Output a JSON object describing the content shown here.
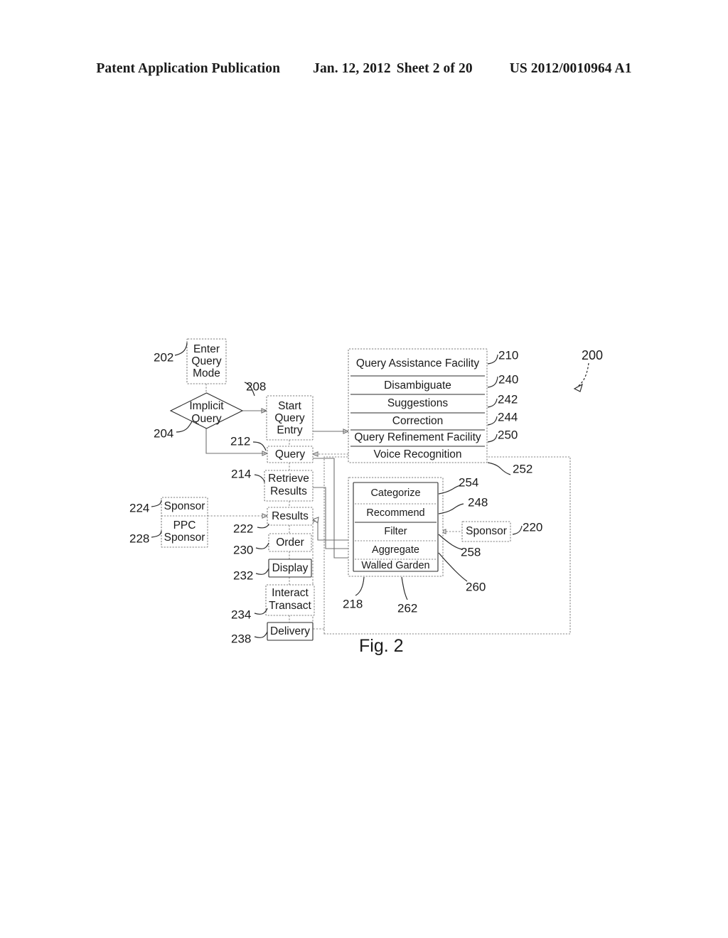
{
  "header": {
    "title": "Patent Application Publication",
    "date": "Jan. 12, 2012",
    "sheet": "Sheet 2 of 20",
    "pub_number": "US 2012/0010964 A1"
  },
  "figure": {
    "caption": "Fig. 2",
    "overall_ref": "200",
    "nodes": {
      "enter_query_mode": {
        "label_lines": [
          "Enter",
          "Query",
          "Mode"
        ],
        "ref": "202"
      },
      "implicit_query": {
        "label_lines": [
          "Implicit",
          "Query"
        ],
        "ref": "204"
      },
      "start_query_entry": {
        "label_lines": [
          "Start",
          "Query",
          "Entry"
        ],
        "ref": "208"
      },
      "query": {
        "label_lines": [
          "Query"
        ],
        "ref": "212"
      },
      "retrieve_results": {
        "label_lines": [
          "Retrieve",
          "Results"
        ],
        "ref": "214"
      },
      "results": {
        "label_lines": [
          "Results"
        ],
        "ref": "222"
      },
      "order": {
        "label_lines": [
          "Order"
        ],
        "ref": "230"
      },
      "display": {
        "label_lines": [
          "Display"
        ],
        "ref": "232"
      },
      "interact_transact": {
        "label_lines": [
          "Interact",
          "Transact"
        ],
        "ref": "234"
      },
      "delivery": {
        "label_lines": [
          "Delivery"
        ],
        "ref": "238"
      },
      "sponsor_left": {
        "label_lines": [
          "Sponsor"
        ],
        "ref": "224"
      },
      "ppc_sponsor": {
        "label_lines": [
          "PPC",
          "Sponsor"
        ],
        "ref": "228"
      },
      "sponsor_right": {
        "label_lines": [
          "Sponsor"
        ],
        "ref": "220"
      }
    },
    "query_assistance_panel": {
      "group_ref": "252",
      "rows": [
        {
          "label": "Query Assistance Facility",
          "ref": "210"
        },
        {
          "label": "Disambiguate",
          "ref": "240"
        },
        {
          "label": "Suggestions",
          "ref": "242"
        },
        {
          "label": "Correction",
          "ref": "244"
        },
        {
          "label": "Query Refinement Facility",
          "ref": "250"
        },
        {
          "label": "Voice Recognition",
          "ref": ""
        }
      ]
    },
    "results_processing_panel": {
      "group_ref": "218",
      "inner_ref": "262",
      "rows": [
        {
          "label": "Categorize",
          "ref": "254"
        },
        {
          "label": "Recommend",
          "ref": "248"
        },
        {
          "label": "Filter",
          "ref": "258"
        },
        {
          "label": "Aggregate",
          "ref": "260"
        },
        {
          "label": "Walled Garden",
          "ref": ""
        }
      ]
    }
  }
}
